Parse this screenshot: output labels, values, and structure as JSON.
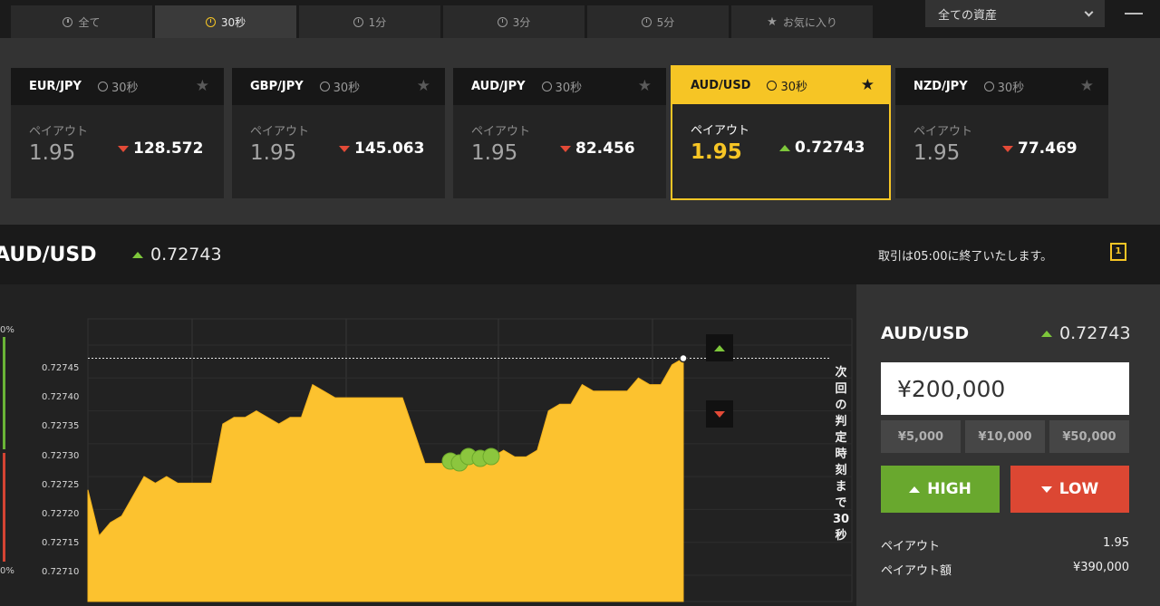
{
  "tabs": [
    {
      "label": "全て",
      "icon": "clock-icon"
    },
    {
      "label": "30秒",
      "icon": "clock-icon",
      "active": true
    },
    {
      "label": "1分",
      "icon": "clock-icon"
    },
    {
      "label": "3分",
      "icon": "clock-icon"
    },
    {
      "label": "5分",
      "icon": "clock-icon"
    },
    {
      "label": "お気に入り",
      "icon": "star-icon"
    }
  ],
  "asset_filter": {
    "selected": "全ての資産"
  },
  "cards": [
    {
      "pair": "EUR/JPY",
      "duration": "30秒",
      "payout_label": "ペイアウト",
      "payout": "1.95",
      "rate": "128.572",
      "direction": "down"
    },
    {
      "pair": "GBP/JPY",
      "duration": "30秒",
      "payout_label": "ペイアウト",
      "payout": "1.95",
      "rate": "145.063",
      "direction": "down"
    },
    {
      "pair": "AUD/JPY",
      "duration": "30秒",
      "payout_label": "ペイアウト",
      "payout": "1.95",
      "rate": "82.456",
      "direction": "down"
    },
    {
      "pair": "AUD/USD",
      "duration": "30秒",
      "payout_label": "ペイアウト",
      "payout": "1.95",
      "rate": "0.72743",
      "direction": "up",
      "selected": true
    },
    {
      "pair": "NZD/JPY",
      "duration": "30秒",
      "payout_label": "ペイアウト",
      "payout": "1.95",
      "rate": "77.469",
      "direction": "down"
    }
  ],
  "info": {
    "symbol": "AUD/USD",
    "rate": "0.72743",
    "message": "取引は05:00に終了いたします。",
    "alert_icon_text": "1"
  },
  "chart": {
    "pct_top": "0%",
    "pct_bottom": "0%",
    "y_labels": [
      "0.72745",
      "0.72740",
      "0.72735",
      "0.72730",
      "0.72725",
      "0.72720",
      "0.72715",
      "0.72710"
    ],
    "countdown": "次回の判定時刻まで30秒"
  },
  "chart_data": {
    "type": "area",
    "ylim": [
      0.72706,
      0.72749
    ],
    "ylabel": "",
    "current": 0.72743,
    "values": [
      0.72723,
      0.72716,
      0.72718,
      0.72719,
      0.72722,
      0.72725,
      0.72724,
      0.72725,
      0.72724,
      0.72724,
      0.72724,
      0.72724,
      0.72733,
      0.72734,
      0.72734,
      0.72735,
      0.72734,
      0.72733,
      0.72734,
      0.72734,
      0.72739,
      0.72738,
      0.72737,
      0.72737,
      0.72737,
      0.72737,
      0.72737,
      0.72737,
      0.72737,
      0.72732,
      0.72727,
      0.72727,
      0.72727,
      0.72728,
      0.72728,
      0.72728,
      0.72728,
      0.72729,
      0.72728,
      0.72728,
      0.72729,
      0.72735,
      0.72736,
      0.72736,
      0.72739,
      0.72738,
      0.72738,
      0.72738,
      0.72738,
      0.7274,
      0.72739,
      0.72739,
      0.72742,
      0.72743
    ]
  },
  "trade": {
    "symbol": "AUD/USD",
    "rate": "0.72743",
    "amount": "¥200,000",
    "presets": [
      "¥5,000",
      "¥10,000",
      "¥50,000"
    ],
    "high_label": "HIGH",
    "low_label": "LOW",
    "payout_label": "ペイアウト",
    "payout_value": "1.95",
    "payout_amount_label": "ペイアウト額",
    "payout_amount_value": "¥390,000"
  },
  "colors": {
    "accent": "#f6c525",
    "up": "#7ec73b",
    "down": "#e34a37",
    "high": "#69a82e",
    "low": "#dc4733"
  }
}
